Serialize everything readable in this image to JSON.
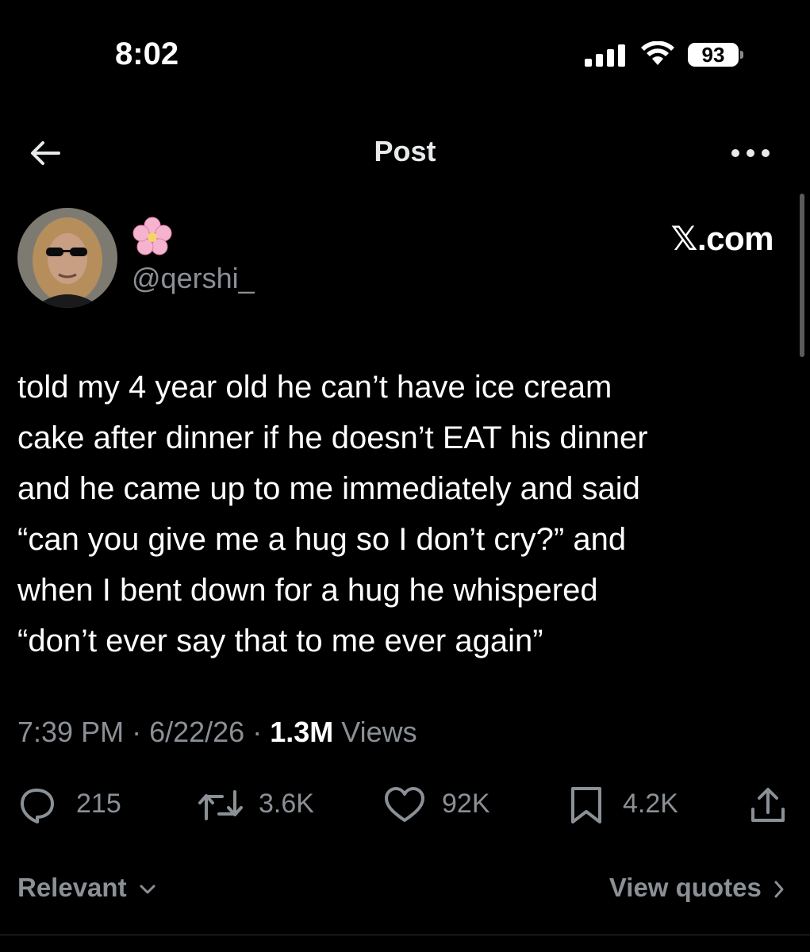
{
  "status_bar": {
    "time": "8:02",
    "battery": "93"
  },
  "header": {
    "title": "Post"
  },
  "author": {
    "display_name_icon": "cherry-blossom-emoji",
    "handle": "@qershi_"
  },
  "watermark": "𝕏.com",
  "tweet": {
    "lines": [
      "told my 4 year old he can’t have ice cream",
      "cake after dinner if he doesn’t EAT his dinner",
      "and he came up to me immediately and said",
      "“can you give me a hug so I don’t cry?” and",
      "when I bent down for a hug he whispered",
      "“don’t ever say that to me ever again”"
    ]
  },
  "meta": {
    "time": "7:39 PM",
    "date": "6/22/26",
    "views_count": "1.3M",
    "views_label": "Views"
  },
  "actions": {
    "replies": "215",
    "reposts": "3.6K",
    "likes": "92K",
    "bookmarks": "4.2K"
  },
  "footer": {
    "sort_label": "Relevant",
    "view_quotes_label": "View quotes"
  },
  "colors": {
    "background": "#000000",
    "text_primary": "#e7e9ea",
    "text_secondary": "#8b9096"
  }
}
